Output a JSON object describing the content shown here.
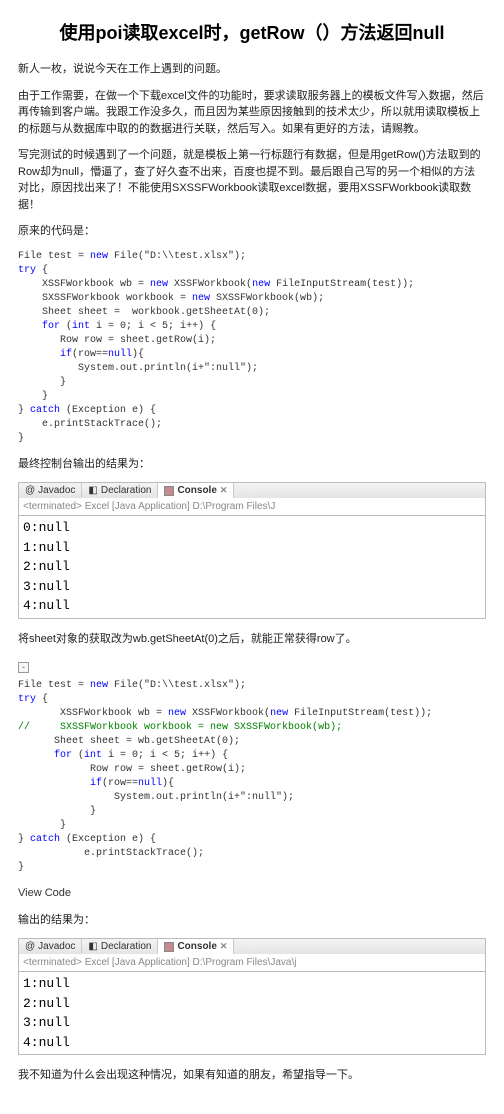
{
  "title": "使用poi读取excel时，getRow（）方法返回null",
  "p_intro": "新人一枚，说说今天在工作上遇到的问题。",
  "p_req": "由于工作需要，在做一个下载excel文件的功能时，要求读取服务器上的模板文件写入数据，然后再传输到客户端。我跟工作没多久，而且因为某些原因接触到的技术太少，所以就用读取模板上的标题与从数据库中取的的数据进行关联，然后写入。如果有更好的方法，请赐教。",
  "p_problem": "写完测试的时候遇到了一个问题，就是模板上第一行标题行有数据，但是用getRow()方法取到的Row却为null，懵逼了，查了好久查不出来，百度也提不到。最后跟自己写的另一个相似的方法对比，原因找出来了！不能使用SXSSFWorkbook读取excel数据，要用XSSFWorkbook读取数据！",
  "p_origcode": "原来的代码是：",
  "code1": {
    "l1a": "File test = ",
    "l1b": "new",
    "l1c": " File(\"D:\\\\test.xlsx\");",
    "l2a": "try",
    "l2b": " {",
    "l3a": "    XSSFWorkbook wb = ",
    "l3b": "new",
    "l3c": " XSSFWorkbook(",
    "l3d": "new",
    "l3e": " FileInputStream(test));",
    "l4a": "    SXSSFWorkbook workbook = ",
    "l4b": "new",
    "l4c": " SXSSFWorkbook(wb);",
    "l5": "    Sheet sheet =  workbook.getSheetAt(0);",
    "l6a": "    for",
    "l6b": " (",
    "l6c": "int",
    "l6d": " i = 0; i < 5; i++) {",
    "l7": "       Row row = sheet.getRow(i);",
    "l8a": "       if",
    "l8b": "(row==",
    "l8c": "null",
    "l8d": "){",
    "l9": "          System.out.println(i+\":null\");",
    "l10": "       }",
    "l11": "    }",
    "l12a": "} ",
    "l12b": "catch",
    "l12c": " (Exception e) {",
    "l13": "    e.printStackTrace();",
    "l14": "}"
  },
  "p_finalout": "最终控制台输出的结果为：",
  "ide1": {
    "tabs": [
      "Javadoc",
      "Declaration",
      "Console"
    ],
    "termline": "<terminated> Excel [Java Application] D:\\Program Files\\J",
    "out": "0:null\n1:null\n2:null\n3:null\n4:null"
  },
  "p_after": "将sheet对象的获取改为wb.getSheetAt(0)之后，就能正常获得row了。",
  "code2": {
    "l1a": "File test = ",
    "l1b": "new",
    "l1c": " File(\"D:\\\\test.xlsx\");",
    "l2a": "try",
    "l2b": " {",
    "l3a": "       XSSFWorkbook wb = ",
    "l3b": "new",
    "l3c": " XSSFWorkbook(",
    "l3d": "new",
    "l3e": " FileInputStream(test));",
    "l4a": "//",
    "l4b": "     SXSSFWorkbook workbook = new SXSSFWorkbook(wb);",
    "l5": "      Sheet sheet = wb.getSheetAt(0);",
    "l6a": "      for",
    "l6b": " (",
    "l6c": "int",
    "l6d": " i = 0; i < 5; i++) {",
    "l7": "            Row row = sheet.getRow(i);",
    "l8a": "            if",
    "l8b": "(row==",
    "l8c": "null",
    "l8d": "){",
    "l9": "                System.out.println(i+\":null\");",
    "l10": "            }",
    "l11": "       }",
    "l12a": "} ",
    "l12b": "catch",
    "l12c": " (Exception e) {",
    "l13": "           e.printStackTrace();",
    "l14": "}"
  },
  "viewcode": "View Code",
  "p_out2": "输出的结果为：",
  "ide2": {
    "tabs": [
      "Javadoc",
      "Declaration",
      "Console"
    ],
    "termline": "<terminated> Excel [Java Application] D:\\Program Files\\Java\\j",
    "out": "1:null\n2:null\n3:null\n4:null"
  },
  "p_end": "我不知道为什么会出现这种情况，如果有知道的朋友，希望指导一下。"
}
